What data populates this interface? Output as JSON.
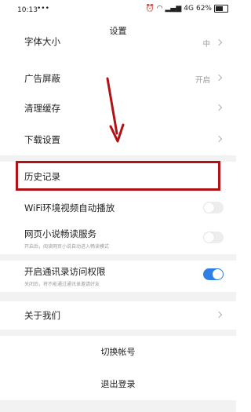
{
  "status_bar": {
    "time": "10:13",
    "dots": "•••",
    "network": "4G",
    "battery": "62%"
  },
  "header": {
    "title": "设置"
  },
  "settings": {
    "font_size": {
      "label": "字体大小",
      "value": "中"
    },
    "ad_block": {
      "label": "广告屏蔽",
      "value": "开启"
    },
    "clear_cache": {
      "label": "清理缓存"
    },
    "download_settings": {
      "label": "下载设置"
    },
    "history": {
      "label": "历史记录"
    },
    "wifi_autoplay": {
      "label": "WiFi环境视频自动播放",
      "on": false
    },
    "web_novel": {
      "label": "网页小说畅读服务",
      "sub": "开启后，阅读网页小说自动进入畅读模式",
      "on": false
    },
    "contacts": {
      "label": "开启通讯录访问权限",
      "sub": "关闭后，将不能通过通讯录邀请好友",
      "on": true
    },
    "about": {
      "label": "关于我们"
    },
    "switch_account": {
      "label": "切换帐号"
    },
    "logout": {
      "label": "退出登录"
    }
  },
  "colors": {
    "accent": "#2f7fe6",
    "highlight": "#b01217",
    "divider": "#f2f2f2"
  },
  "annotation": {
    "type": "arrow-and-box",
    "target": "历史记录"
  }
}
